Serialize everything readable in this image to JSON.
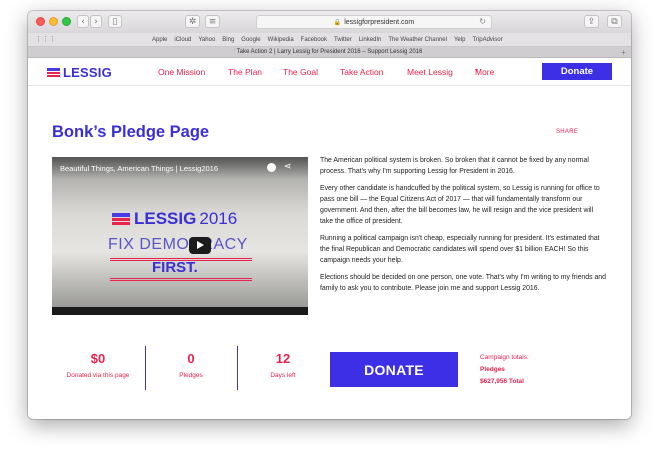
{
  "browser": {
    "url": "lessigforpresident.com",
    "favorites": [
      "Apple",
      "iCloud",
      "Yahoo",
      "Bing",
      "Google",
      "Wikipedia",
      "Facebook",
      "Twitter",
      "LinkedIn",
      "The Weather Channel",
      "Yelp",
      "TripAdvisor"
    ],
    "tab_title": "Take Action 2 | Larry Lessig for President 2016 – Support Lessig 2016"
  },
  "nav": {
    "logo": "LESSIG",
    "links": [
      "One Mission",
      "The Plan",
      "The Goal",
      "Take Action",
      "Meet Lessig",
      "More"
    ],
    "donate": "Donate"
  },
  "page": {
    "title": "Bonk’s Pledge Page",
    "share": "SHARE"
  },
  "video": {
    "title": "Beautiful Things, American Things | Lessig2016",
    "logo_text": "LESSIG",
    "logo_year": "2016",
    "line1": "FIX DEMOCRACY",
    "line2": "FIRST."
  },
  "body": {
    "paragraphs": [
      "The American political system is broken. So broken that it cannot be fixed by any normal process. That's why I'm supporting Lessig for President in 2016.",
      "Every other candidate is handcuffed by the political system, so Lessig is running for office to pass one bill — the Equal Citizens Act of 2017 — that will fundamentally transform our government. And then, after the bill becomes law, he will resign and the vice president will take the office of president.",
      "Running a political campaign isn't cheap, especially running for president. It's estimated that the final Republican and Democratic candidates will spend over $1 billion EACH! So this campaign needs your help.",
      "Elections should be decided on one person, one vote. That's why I'm writing to my friends and family to ask you to contribute. Please join me and support Lessig 2016."
    ]
  },
  "stats": {
    "donated": {
      "value": "$0",
      "label": "Donated via this page"
    },
    "pledges": {
      "value": "0",
      "label": "Pledges"
    },
    "days": {
      "value": "12",
      "label": "Days left"
    }
  },
  "donate_button": "DONATE",
  "totals": {
    "heading": "Campaign totals:",
    "pledges_label": "Pledges",
    "amount": "$627,956 Total"
  },
  "colors": {
    "brand_blue": "#3c2fe6",
    "brand_red": "#e9234e"
  }
}
